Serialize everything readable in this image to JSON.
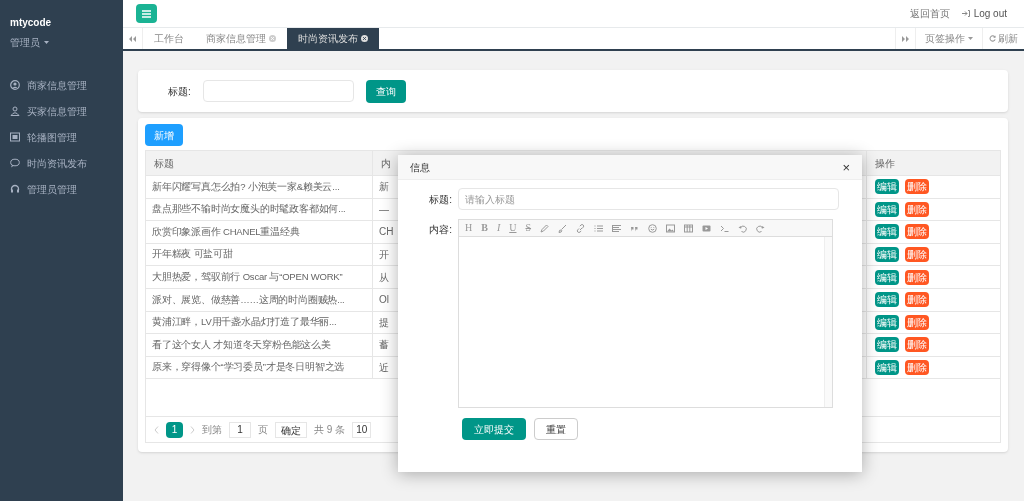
{
  "sidebar": {
    "brand": "mtycode",
    "role": "管理员",
    "items": [
      {
        "label": "商家信息管理"
      },
      {
        "label": "买家信息管理"
      },
      {
        "label": "轮播图管理"
      },
      {
        "label": "时尚资讯发布"
      },
      {
        "label": "管理员管理"
      }
    ]
  },
  "topbar": {
    "links": [
      "返回首页",
      "Log out"
    ]
  },
  "tabs": [
    {
      "label": "工作台",
      "closable": false,
      "selected": false
    },
    {
      "label": "商家信息管理",
      "closable": true,
      "selected": false
    },
    {
      "label": "时尚资讯发布",
      "closable": true,
      "selected": true
    }
  ],
  "tab_actions": [
    "页签操作",
    "刷新"
  ],
  "search": {
    "label": "标题:",
    "button": "查询"
  },
  "add_button": "新增",
  "table": {
    "columns": [
      "标题",
      "内",
      "操作"
    ],
    "rows": [
      {
        "title": "新年闪耀写真怎么拍? 小泡芙一家&赖美云...",
        "content": "新",
        "actions": [
          "编辑",
          "删除"
        ]
      },
      {
        "title": "盘点那些不输时尚女魔头的时髦政客都如何...",
        "content": "—",
        "actions": [
          "编辑",
          "删除"
        ]
      },
      {
        "title": "欣赏印象派画作 CHANEL重温经典",
        "content": "CH",
        "actions": [
          "编辑",
          "删除"
        ]
      },
      {
        "title": "开年糕夜 可盐可甜",
        "content": "开",
        "actions": [
          "编辑",
          "删除"
        ]
      },
      {
        "title": "大胆热爱，驾驭前行 Oscar 与“OPEN WORK”",
        "content": "从",
        "actions": [
          "编辑",
          "删除"
        ]
      },
      {
        "title": "派对、展览、做慈善……这周的时尚圈贼热...",
        "content": "Ol",
        "actions": [
          "编辑",
          "删除"
        ]
      },
      {
        "title": "黄浦江畔，LV用千盏水晶灯打造了最华丽...",
        "content": "提",
        "actions": [
          "编辑",
          "删除"
        ]
      },
      {
        "title": "看了这个女人 才知道冬天穿粉色能这么美",
        "content": "蓄",
        "actions": [
          "编辑",
          "删除"
        ]
      },
      {
        "title": "原来，穿得像个“学习委员”才是冬日明智之选",
        "content": "近",
        "actions": [
          "编辑",
          "删除"
        ]
      }
    ]
  },
  "pagination": {
    "pages": [
      {
        "label": "1",
        "selected": true
      }
    ],
    "goto_label": "到第",
    "goto_value": "1",
    "page_unit": "页",
    "confirm": "确定",
    "total": "共 9 条",
    "page_size": "10"
  },
  "dialog": {
    "title": "信息",
    "close": "×",
    "title_label": "标题:",
    "title_placeholder": "请输入标题",
    "content_label": "内容:",
    "toolbar_letters": [
      "H",
      "B",
      "I",
      "U",
      "S"
    ],
    "submit": "立即提交",
    "reset": "重置"
  }
}
